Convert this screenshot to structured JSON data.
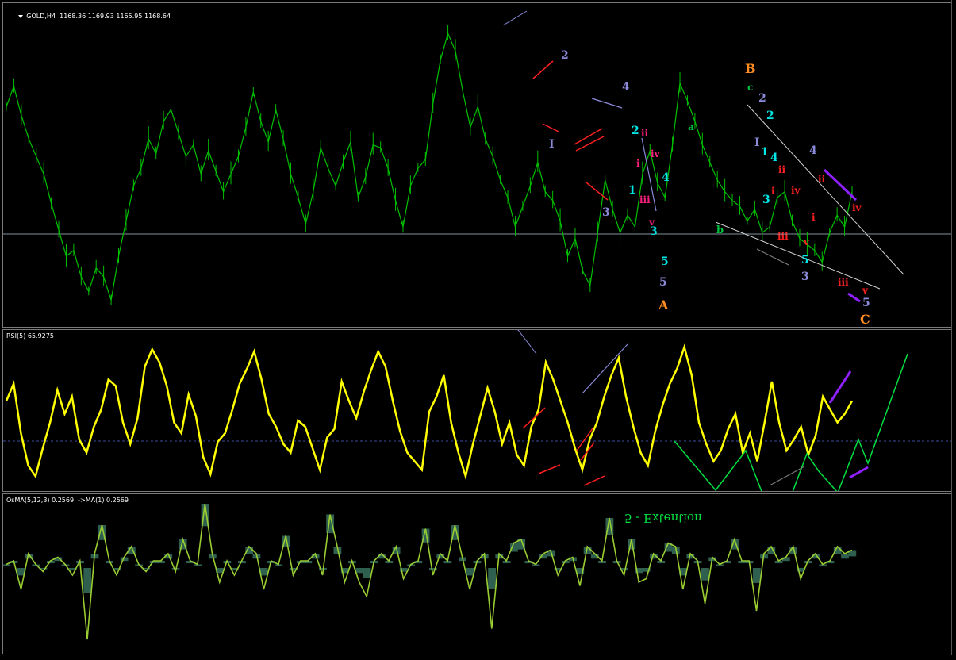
{
  "price_pane": {
    "symbol_label": "GOLD,H4",
    "ohlc_label": "1168.36 1169.93 1165.95 1168.64",
    "wave_labels": [
      {
        "text": "2",
        "color": "#8a8ad8"
      },
      {
        "text": "I",
        "color": "#8a8ad8"
      },
      {
        "text": "4",
        "color": "#8a8ad8"
      },
      {
        "text": "3",
        "color": "#8a8ad8"
      },
      {
        "text": "2",
        "color": "#00e5e5"
      },
      {
        "text": "ii",
        "color": "#ff2080"
      },
      {
        "text": "iv",
        "color": "#ff2080"
      },
      {
        "text": "i",
        "color": "#ff2080"
      },
      {
        "text": "4",
        "color": "#00e5e5"
      },
      {
        "text": "1",
        "color": "#00e5e5"
      },
      {
        "text": "iii",
        "color": "#ff2080"
      },
      {
        "text": "v",
        "color": "#ff2080"
      },
      {
        "text": "3",
        "color": "#00e5e5"
      },
      {
        "text": "5",
        "color": "#00e5e5"
      },
      {
        "text": "5",
        "color": "#8a8ad8"
      },
      {
        "text": "A",
        "color": "#ff8c20"
      },
      {
        "text": "a",
        "color": "#00c040"
      },
      {
        "text": "b",
        "color": "#00c040"
      },
      {
        "text": "B",
        "color": "#ff8c20"
      },
      {
        "text": "c",
        "color": "#00c040"
      },
      {
        "text": "2",
        "color": "#8a8ad8"
      },
      {
        "text": "2",
        "color": "#00e5e5"
      },
      {
        "text": "I",
        "color": "#8a8ad8"
      },
      {
        "text": "1",
        "color": "#00e5e5"
      },
      {
        "text": "4",
        "color": "#00e5e5"
      },
      {
        "text": "ii",
        "color": "#ff2020"
      },
      {
        "text": "i",
        "color": "#ff2020"
      },
      {
        "text": "iv",
        "color": "#ff2020"
      },
      {
        "text": "3",
        "color": "#00e5e5"
      },
      {
        "text": "4",
        "color": "#8a8ad8"
      },
      {
        "text": "ii",
        "color": "#ff2020"
      },
      {
        "text": "i",
        "color": "#ff2020"
      },
      {
        "text": "iii",
        "color": "#ff2020"
      },
      {
        "text": "v",
        "color": "#ff2020"
      },
      {
        "text": "5",
        "color": "#00e5e5"
      },
      {
        "text": "3",
        "color": "#8a8ad8"
      },
      {
        "text": "iv",
        "color": "#ff2020"
      },
      {
        "text": "iii",
        "color": "#ff2020"
      },
      {
        "text": "v",
        "color": "#ff2020"
      },
      {
        "text": "5",
        "color": "#8a8ad8"
      },
      {
        "text": "C",
        "color": "#ff8c20"
      }
    ]
  },
  "rsi_pane": {
    "label": "RSI(5) 65.9275",
    "annotation": "5 - Extention",
    "annotation_color": "#00e040"
  },
  "osma_pane": {
    "label": "OsMA(5,12,3) 0.2569  ->MA(1) 0.2569"
  },
  "colors": {
    "background": "#000000",
    "price_candles": "#00c000",
    "rsi_line": "#ffff00",
    "osma_line": "#9acd32",
    "osma_fill": "#2f5f4f",
    "grid_line": "#8090a0",
    "trend_white": "#d0d0d0",
    "trend_red": "#ff2020",
    "trend_purple": "#9020ff",
    "trend_lavender": "#8a8ad8",
    "projection_green": "#00e040"
  },
  "chart_data": [
    {
      "type": "line",
      "title": "GOLD,H4",
      "series": [
        {
          "values": [
            1189,
            1196,
            1186,
            1178,
            1172,
            1166,
            1156,
            1147,
            1138,
            1140,
            1131,
            1126,
            1134,
            1131,
            1123,
            1138,
            1150,
            1162,
            1168,
            1178,
            1173,
            1184,
            1188,
            1180,
            1172,
            1176,
            1166,
            1174,
            1167,
            1160,
            1166,
            1172,
            1182,
            1194,
            1184,
            1177,
            1188,
            1178,
            1166,
            1158,
            1149,
            1160,
            1175,
            1168,
            1162,
            1170,
            1177,
            1158,
            1165,
            1176,
            1175,
            1168,
            1157,
            1148,
            1162,
            1168,
            1171,
            1190,
            1205,
            1214,
            1208,
            1194,
            1182,
            1189,
            1178,
            1172,
            1164,
            1158,
            1148,
            1155,
            1162,
            1170,
            1160,
            1157,
            1150,
            1138,
            1144,
            1133,
            1128,
            1146,
            1164,
            1154,
            1146,
            1152,
            1148,
            1166,
            1174,
            1163,
            1158,
            1176,
            1197,
            1191,
            1184,
            1176,
            1170,
            1164,
            1160,
            1157,
            1155,
            1150,
            1154,
            1146,
            1148,
            1158,
            1160,
            1150,
            1144,
            1142,
            1140,
            1136,
            1146,
            1152,
            1148,
            1160
          ]
        }
      ]
    },
    {
      "type": "line",
      "title": "RSI(5) 65.9275",
      "series": [
        {
          "values": [
            70,
            78,
            55,
            40,
            35,
            48,
            60,
            75,
            64,
            72,
            52,
            46,
            58,
            66,
            80,
            77,
            60,
            50,
            62,
            86,
            94,
            88,
            77,
            60,
            55,
            73,
            63,
            44,
            36,
            51,
            55,
            66,
            78,
            85,
            93,
            80,
            64,
            58,
            50,
            46,
            61,
            58,
            48,
            38,
            53,
            57,
            79,
            70,
            62,
            74,
            84,
            93,
            86,
            70,
            56,
            46,
            42,
            38,
            65,
            72,
            82,
            60,
            46,
            35,
            50,
            63,
            76,
            65,
            50,
            60,
            45,
            40,
            58,
            66,
            88,
            80,
            70,
            60,
            48,
            38,
            52,
            60,
            72,
            82,
            90,
            72,
            58,
            46,
            40,
            56,
            68,
            78,
            85,
            95,
            82,
            60,
            50,
            42,
            47,
            57,
            64,
            46,
            55,
            42,
            60,
            79,
            60,
            47,
            52,
            58,
            45,
            54,
            72,
            66,
            60,
            64,
            70
          ]
        }
      ]
    },
    {
      "type": "area",
      "title": "OsMA(5,12,3)",
      "series": [
        {
          "values": [
            0.05,
            0.1,
            -0.3,
            0.2,
            0.05,
            -0.05,
            0.1,
            0.15,
            0.05,
            -0.1,
            0.1,
            -1.0,
            0.2,
            0.6,
            0.1,
            -0.1,
            0.15,
            0.3,
            0.05,
            -0.05,
            0.1,
            0.1,
            0.2,
            -0.05,
            0.4,
            0.1,
            0.05,
            0.9,
            0.2,
            -0.2,
            0.1,
            -0.1,
            0.1,
            0.3,
            0.2,
            -0.3,
            0.1,
            0.05,
            0.45,
            -0.1,
            0.1,
            0.1,
            0.2,
            -0.1,
            0.75,
            0.3,
            -0.2,
            0.1,
            -0.2,
            -0.4,
            0.1,
            0.2,
            0.1,
            0.3,
            -0.15,
            0.05,
            0.1,
            0.55,
            -0.1,
            0.2,
            0.1,
            0.6,
            0.15,
            -0.3,
            0.1,
            0.2,
            -0.85,
            0.2,
            0.1,
            0.35,
            0.4,
            0.1,
            0.05,
            0.2,
            0.25,
            -0.1,
            0.1,
            0.15,
            -0.25,
            0.3,
            0.2,
            0.1,
            0.7,
            0.1,
            -0.1,
            0.4,
            -0.2,
            -0.15,
            0.2,
            0.1,
            0.35,
            0.3,
            -0.3,
            0.2,
            0.1,
            -0.5,
            0.15,
            0.05,
            0.1,
            0.4,
            0.1,
            0.1,
            -0.6,
            0.2,
            0.3,
            0.1,
            0.15,
            0.3,
            -0.15,
            0.1,
            0.2,
            0.05,
            0.1,
            0.3,
            0.2,
            0.25
          ]
        }
      ]
    }
  ]
}
